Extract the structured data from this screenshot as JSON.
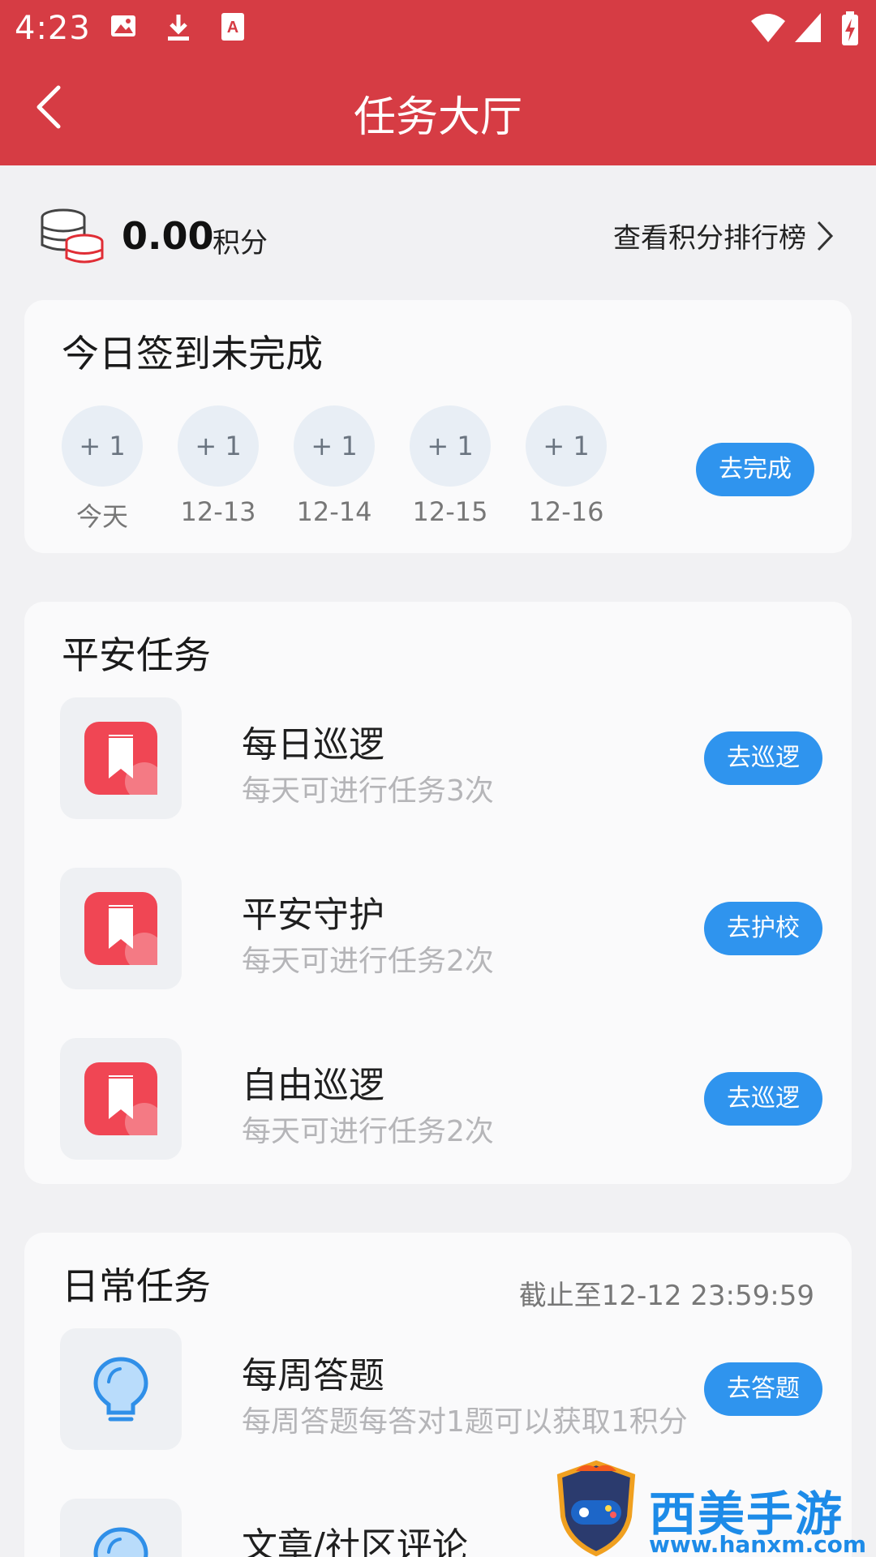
{
  "status_bar": {
    "time": "4:23",
    "icons": [
      "image-icon",
      "download-icon",
      "text-recognition-icon",
      "wifi-icon",
      "signal-icon",
      "battery-charging-icon"
    ]
  },
  "app_bar": {
    "title": "任务大厅",
    "color": "#d63c44"
  },
  "points": {
    "value": "0.00",
    "unit": "积分",
    "leaderboard_link": "查看积分排行榜"
  },
  "checkin": {
    "title": "今日签到未完成",
    "days": [
      {
        "reward": "+ 1",
        "label": "今天"
      },
      {
        "reward": "+ 1",
        "label": "12-13"
      },
      {
        "reward": "+ 1",
        "label": "12-14"
      },
      {
        "reward": "+ 1",
        "label": "12-15"
      },
      {
        "reward": "+ 1",
        "label": "12-16"
      }
    ],
    "button": "去完成"
  },
  "safety_tasks": {
    "title": "平安任务",
    "items": [
      {
        "name": "每日巡逻",
        "desc": "每天可进行任务3次",
        "button": "去巡逻",
        "icon": "bookmark-icon"
      },
      {
        "name": "平安守护",
        "desc": "每天可进行任务2次",
        "button": "去护校",
        "icon": "bookmark-icon"
      },
      {
        "name": "自由巡逻",
        "desc": "每天可进行任务2次",
        "button": "去巡逻",
        "icon": "bookmark-icon"
      }
    ]
  },
  "daily_tasks": {
    "title": "日常任务",
    "deadline": "截止至12-12 23:59:59",
    "items": [
      {
        "name": "每周答题",
        "desc": "每周答题每答对1题可以获取1积分",
        "button": "去答题",
        "icon": "lightbulb-icon"
      },
      {
        "name": "文章/社区评论",
        "desc": "",
        "button": "",
        "icon": "lightbulb-icon"
      }
    ]
  },
  "watermark": {
    "title": "西美手游网",
    "url": "www.hanxm.com"
  },
  "colors": {
    "primary_red": "#d63c44",
    "button_blue": "#2f94ee",
    "bookmark_red": "#f04654"
  }
}
